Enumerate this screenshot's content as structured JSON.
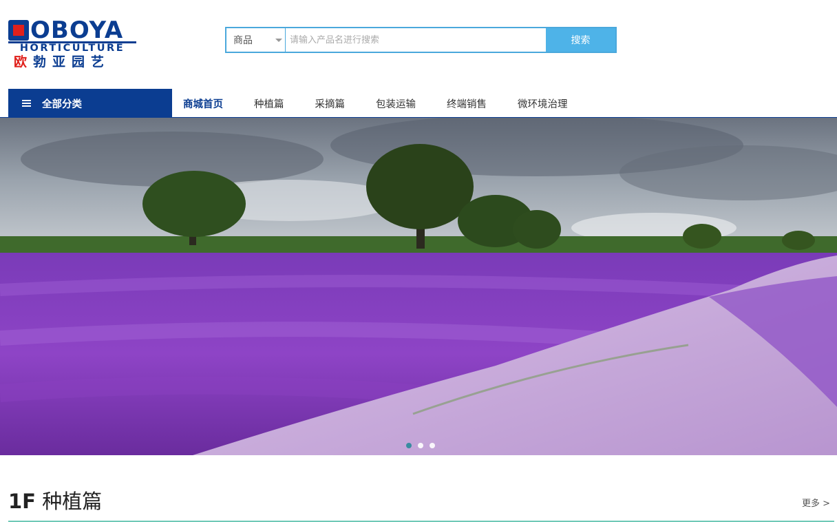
{
  "logo": {
    "brand": "OBOYA",
    "subtitle": "HORTICULTURE",
    "chinese_first": "欧",
    "chinese_rest": "勃亚园艺"
  },
  "search": {
    "category": "商品",
    "placeholder": "请输入产品名进行搜索",
    "button_label": "搜索"
  },
  "nav": {
    "all_categories": "全部分类",
    "items": [
      {
        "label": "商城首页",
        "active": true
      },
      {
        "label": "种植篇"
      },
      {
        "label": "采摘篇"
      },
      {
        "label": "包装运输"
      },
      {
        "label": "终端销售"
      },
      {
        "label": "微环境治理"
      }
    ]
  },
  "banner": {
    "slides": 3,
    "active_slide": 1
  },
  "floor": {
    "number": "1F",
    "title": "种植篇",
    "more": "更多 >"
  },
  "colors": {
    "brand_blue": "#0b3d91",
    "search_blue": "#4eb3e8",
    "floor_line": "#6fc9b7"
  }
}
